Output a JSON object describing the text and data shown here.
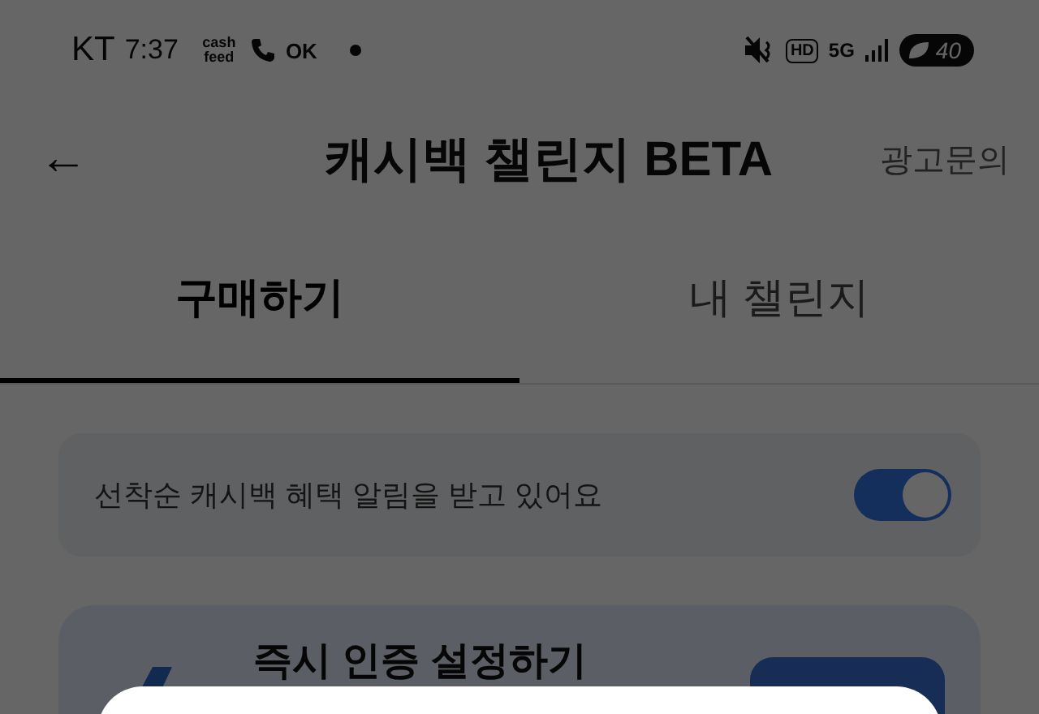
{
  "status_bar": {
    "carrier": "KT",
    "time": "7:37",
    "notifications": [
      "cash feed",
      "OK"
    ],
    "hd": "HD",
    "network": "5G",
    "battery": "40"
  },
  "header": {
    "back": "←",
    "title": "캐시백 챌린지 BETA",
    "action": "광고문의"
  },
  "tabs": [
    {
      "label": "구매하기",
      "selected": true
    },
    {
      "label": "내 챌린지",
      "selected": false
    }
  ],
  "notice": {
    "text": "선착순 캐시백 혜택 알림을 받고 있어요",
    "on": true
  },
  "card": {
    "title": "즉시 인증 설정하기"
  },
  "sheet": {
    "kind": "bottom-sheet"
  }
}
